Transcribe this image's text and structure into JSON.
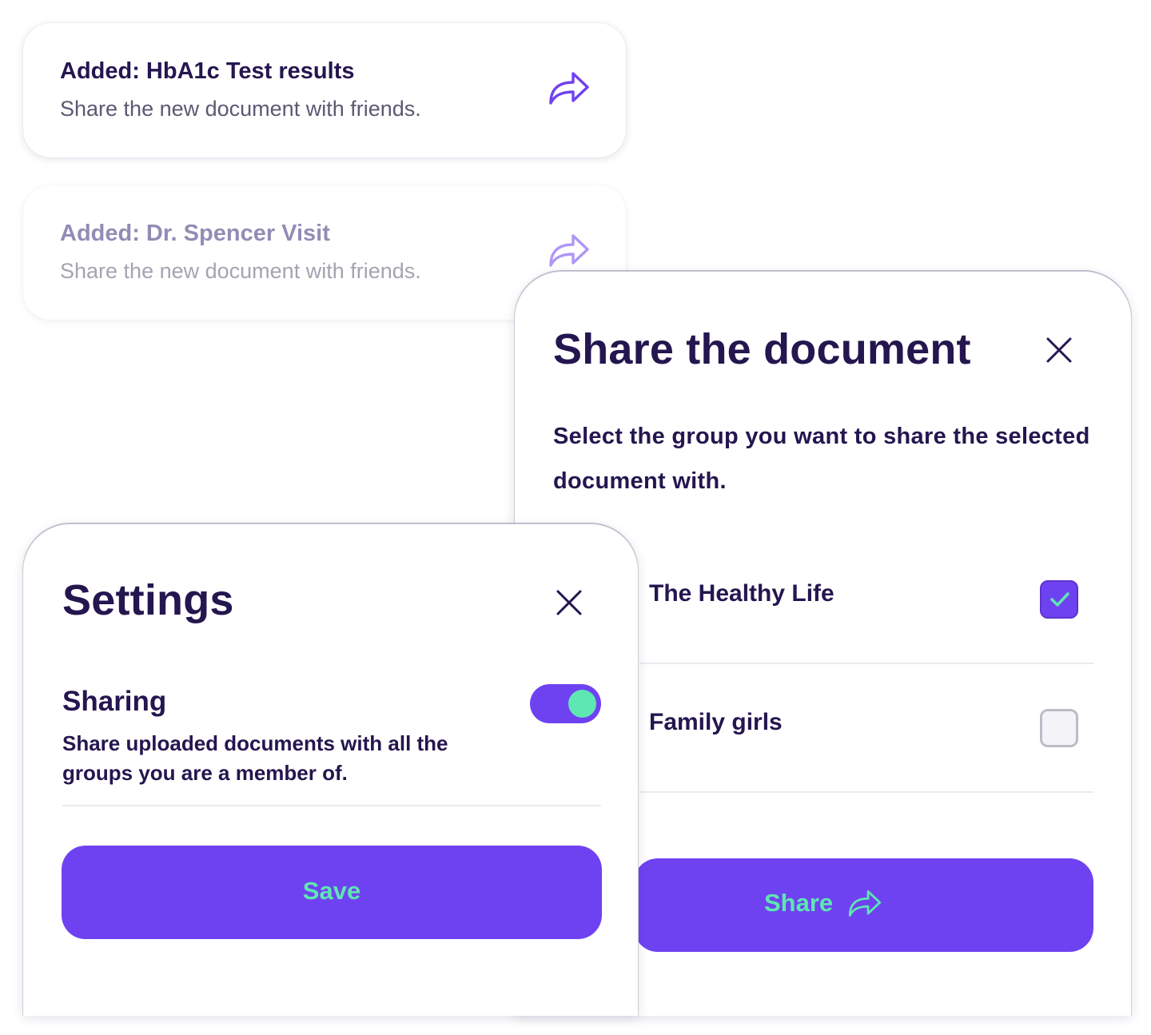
{
  "notifications": [
    {
      "title": "Added: HbA1c Test results",
      "subtitle": "Share the new document with friends.",
      "icon": "share-arrow-icon"
    },
    {
      "title": "Added: Dr. Spencer Visit",
      "subtitle": "Share the new document with friends.",
      "icon": "share-arrow-icon"
    }
  ],
  "share_dialog": {
    "title": "Share the document",
    "description": "Select the group you want to share the selected document with.",
    "groups": [
      {
        "label": "The Healthy Life",
        "checked": true
      },
      {
        "label": "Family girls",
        "checked": false
      }
    ],
    "button_label": "Share",
    "close_icon": "close-icon"
  },
  "settings_dialog": {
    "title": "Settings",
    "setting": {
      "heading": "Sharing",
      "description": "Share uploaded documents with all the groups you are a member of.",
      "enabled": true
    },
    "button_label": "Save",
    "close_icon": "close-icon"
  },
  "colors": {
    "primary": "#6f42f1",
    "accent": "#5ee6b3",
    "text": "#24164f",
    "muted_text": "#5d5872"
  }
}
